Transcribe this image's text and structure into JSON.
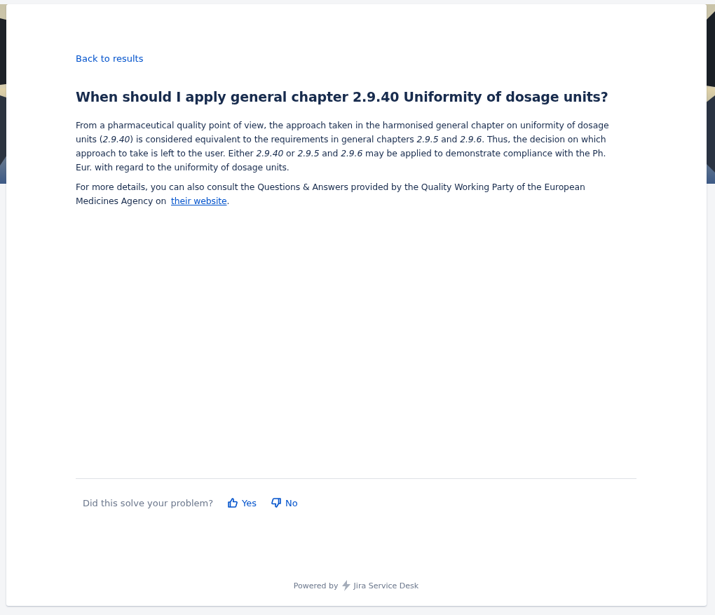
{
  "back_link": "Back to results",
  "article": {
    "title": "When should I apply general chapter 2.9.40 Uniformity of dosage units?",
    "paragraphs": [
      {
        "text": "From a pharmaceutical quality point of view, the approach taken in the harmonised general chapter on uniformity of dosage units (*2.9.40*) is considered equivalent to the requirements in general chapters *2.9.5* and *2.9.6*. Thus, the decision on which approach to take is left to the user. Either *2.9.40* or *2.9.5* and *2.9.6* may be applied to demonstrate compliance with the Ph. Eur. with regard to the uniformity of dosage units."
      },
      {
        "text": "For more details, you can also consult the Questions & Answers provided by the Quality Working Party of the European Medicines Agency on",
        "link": "their website",
        "text_after": "."
      }
    ]
  },
  "feedback": {
    "question": "Did this solve your problem?",
    "buttons": [
      {
        "kind": "up",
        "label": "Yes"
      },
      {
        "kind": "down",
        "label": "No"
      }
    ]
  },
  "footer": {
    "prefix": "Powered by",
    "product": "Jira Service Desk"
  }
}
